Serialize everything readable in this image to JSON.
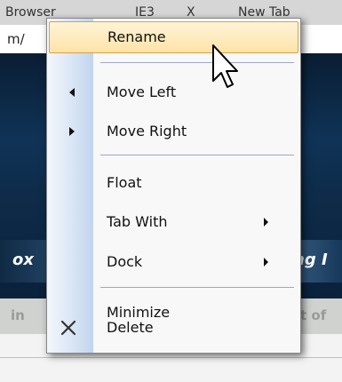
{
  "background": {
    "tabs": [
      "Browser",
      "IE3",
      "X",
      "New Tab"
    ],
    "address_text": "m/",
    "banner_left": "ox",
    "banner_right": "ng I",
    "strip_left": "in",
    "strip_right": "t of"
  },
  "context_menu": {
    "items": [
      {
        "label": "Rename",
        "icon": "none",
        "highlighted": true,
        "submenu": false
      },
      {
        "label": "Move Left",
        "icon": "arrow-left-icon",
        "submenu": false
      },
      {
        "label": "Move Right",
        "icon": "arrow-right-icon",
        "submenu": false
      },
      {
        "label": "Float",
        "icon": "none",
        "submenu": false
      },
      {
        "label": "Tab With",
        "icon": "none",
        "submenu": true
      },
      {
        "label": "Dock",
        "icon": "none",
        "submenu": true
      },
      {
        "label": "Minimize",
        "icon": "none",
        "submenu": false
      },
      {
        "label": "Delete",
        "icon": "close-icon",
        "submenu": false
      }
    ]
  },
  "colors": {
    "highlight": "#fde3a7",
    "highlight_border": "#d7a24a",
    "gutter": "#c2d4ee"
  }
}
